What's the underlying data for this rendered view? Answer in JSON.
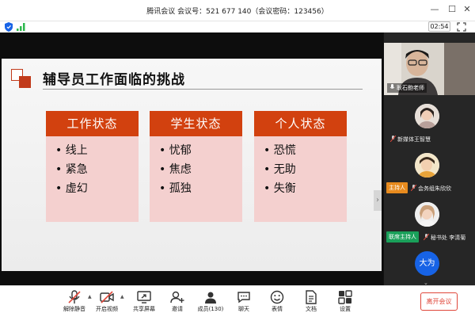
{
  "window": {
    "title": "腾讯会议 会议号：521 677 140（会议密码：123456）",
    "minimize": "—",
    "maximize": "☐",
    "close": "✕"
  },
  "status": {
    "timer": "02:54"
  },
  "slide": {
    "title": "辅导员工作面临的挑战",
    "columns": [
      {
        "heading": "工作状态",
        "items": [
          "线上",
          "紧急",
          "虚幻"
        ]
      },
      {
        "heading": "学生状态",
        "items": [
          "忧郁",
          "焦虑",
          "孤独"
        ]
      },
      {
        "heading": "个人状态",
        "items": [
          "恐慌",
          "无助",
          "失衡"
        ]
      }
    ],
    "nav_arrow": "›"
  },
  "participants": {
    "video": {
      "name": "耿石鲍老师"
    },
    "list": [
      {
        "name": "新媒体王智慧",
        "role": ""
      },
      {
        "name": "会务组朱欣欣",
        "role": "主持人"
      },
      {
        "name": "秘书处 李清菊",
        "role": "联席主持人"
      },
      {
        "name": "",
        "role": "",
        "avatar_text": "大为"
      }
    ]
  },
  "toolbar": {
    "tools": [
      {
        "label": "解除静音",
        "icon": "muted-mic-icon"
      },
      {
        "label": "开启视频",
        "icon": "video-off-icon"
      },
      {
        "label": "共享屏幕",
        "icon": "share-screen-icon"
      },
      {
        "label": "邀请",
        "icon": "invite-icon"
      },
      {
        "label": "成员(130)",
        "icon": "members-icon"
      },
      {
        "label": "聊天",
        "icon": "chat-icon"
      },
      {
        "label": "表情",
        "icon": "emoji-icon"
      },
      {
        "label": "文档",
        "icon": "document-icon"
      },
      {
        "label": "设置",
        "icon": "settings-icon"
      }
    ],
    "leave_label": "离开会议"
  },
  "colors": {
    "accent": "#d2410f",
    "column_bg": "#f4d0cf",
    "cohost_badge": "#1aa05a",
    "host_badge": "#e88b1e",
    "leave": "#e0473a",
    "avatar_blue": "#1763e6"
  }
}
